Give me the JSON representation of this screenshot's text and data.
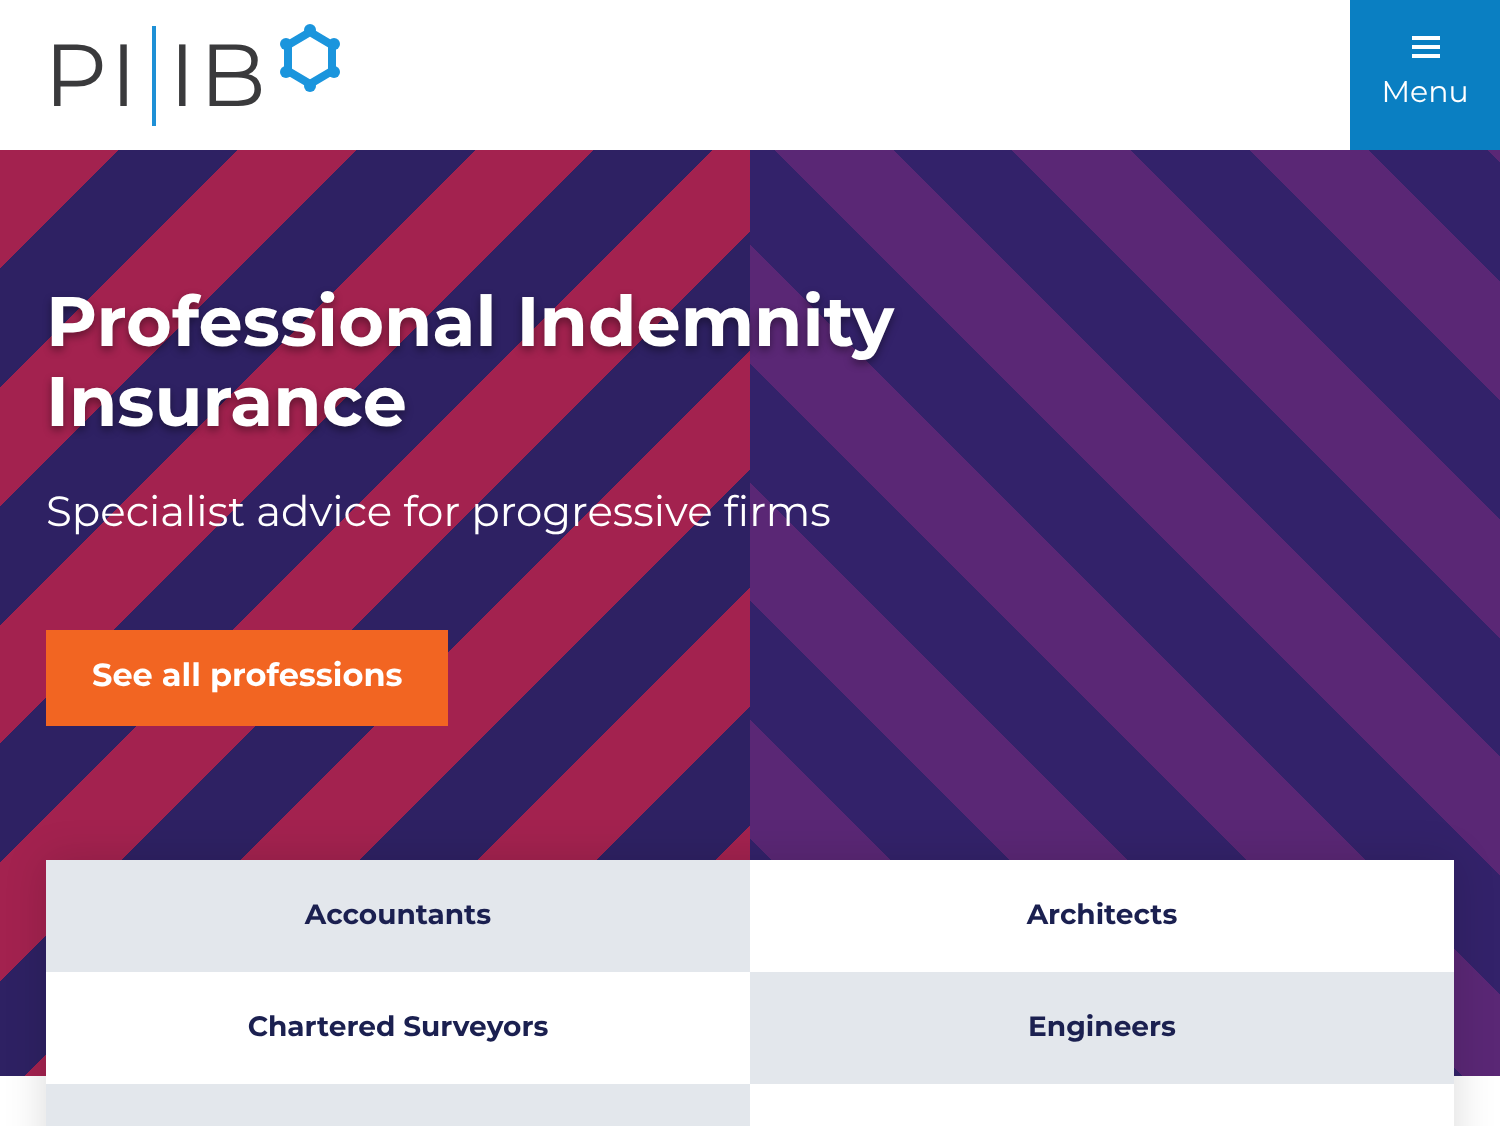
{
  "header": {
    "logo": {
      "left": "PI",
      "right": "IB"
    },
    "menu_button": {
      "label": "Menu"
    }
  },
  "hero": {
    "title": "Professional Indemnity Insurance",
    "subtitle": "Specialist advice for progressive firms",
    "cta": "See all professions"
  },
  "professions": [
    {
      "label": "Accountants",
      "shaded": true
    },
    {
      "label": "Architects",
      "shaded": false
    },
    {
      "label": "Chartered Surveyors",
      "shaded": false
    },
    {
      "label": "Engineers",
      "shaded": true
    },
    {
      "shaded": true
    },
    {
      "shaded": false
    }
  ]
}
